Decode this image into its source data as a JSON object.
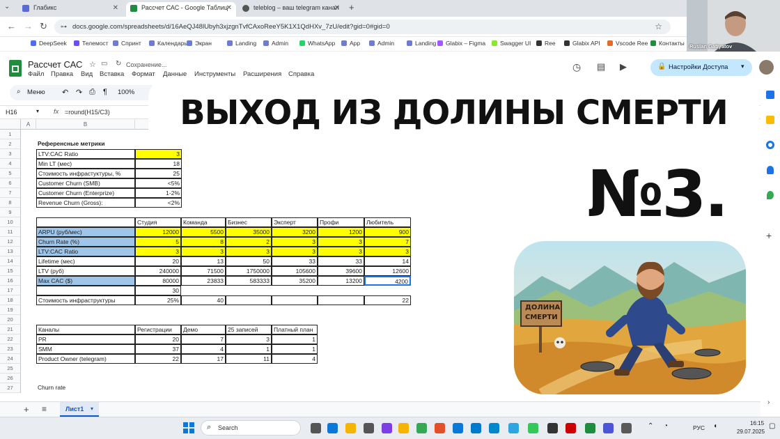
{
  "browser": {
    "tabs": [
      {
        "label": "Глабикс",
        "active": false
      },
      {
        "label": "Рассчет САС - Google Таблиц",
        "active": true
      },
      {
        "label": "teleblog – ваш telegram канал",
        "active": false
      }
    ],
    "url": "docs.google.com/spreadsheets/d/16AeQJ48lUbyh3xjzgnTvfCAxoReeY5K1X1QdHXv_7zU/edit?gid=0#gid=0",
    "bookmarks": [
      "DeepSeek",
      "Телемост",
      "Спринт",
      "Календарь",
      "Экран",
      "Landing",
      "Admin",
      "WhatsApp",
      "App",
      "Admin",
      "Landing",
      "Glabix – Figma",
      "Swagger UI",
      "Ree",
      "Glabix API",
      "Vscode Ree",
      "Контакты"
    ],
    "webcam_name": "Ruslan Gatiyatov"
  },
  "sheets": {
    "title": "Рассчет САС",
    "saving": "Сохранение...",
    "menu": [
      "Файл",
      "Правка",
      "Вид",
      "Вставка",
      "Формат",
      "Данные",
      "Инструменты",
      "Расширения",
      "Справка"
    ],
    "search_label": "Меню",
    "zoom": "100%",
    "share_label": "Настройки Доступа",
    "cell_ref": "H16",
    "formula": "=round(H15/C3)",
    "sheet_tab": "Лист1"
  },
  "grid": {
    "columns": [
      "A",
      "B"
    ],
    "rows": [
      "1",
      "2",
      "3",
      "4",
      "5",
      "6",
      "7",
      "8",
      "9",
      "10",
      "11",
      "12",
      "13",
      "14",
      "15",
      "16",
      "17",
      "18",
      "19",
      "20",
      "21",
      "22",
      "23",
      "24",
      "25",
      "26",
      "27"
    ],
    "metrics_title": "Референсные метрики",
    "metrics": [
      [
        "LTV:CAC Ratio",
        "3"
      ],
      [
        "Min LT (мес)",
        "18"
      ],
      [
        "Стоимость инфрастуктуры, %",
        "25"
      ],
      [
        "Customer Churn (SMB)",
        "<5%"
      ],
      [
        "Customer Churn (Enterprize)",
        "1-2%"
      ],
      [
        "Revenue Churn (Gross):",
        "<2%"
      ]
    ],
    "plans_header": [
      "Студия",
      "Команда",
      "Бизнес",
      "Эксперт",
      "Профи",
      "Любитель"
    ],
    "plans_rows": [
      {
        "label": "ARPU (руб/мес)",
        "values": [
          "12000",
          "5500",
          "35000",
          "3200",
          "1200",
          "900"
        ]
      },
      {
        "label": "Churn Rate (%)",
        "values": [
          "5",
          "8",
          "2",
          "3",
          "3",
          "7"
        ]
      },
      {
        "label": "LTV:CAC Ratio",
        "values": [
          "3",
          "3",
          "3",
          "3",
          "3",
          "3"
        ]
      },
      {
        "label": "Lifetime (мес)",
        "values": [
          "20",
          "13",
          "50",
          "33",
          "33",
          "14"
        ]
      },
      {
        "label": "LTV (руб)",
        "values": [
          "240000",
          "71500",
          "1750000",
          "105600",
          "39600",
          "12600"
        ]
      },
      {
        "label": "Max CAC ($)",
        "values": [
          "80000",
          "23833",
          "583333",
          "35200",
          "13200",
          "4200"
        ]
      }
    ],
    "row17_value": "30",
    "infra_label": "Стоимость инфраструктуры",
    "infra_values": [
      "25%",
      "40",
      "",
      "",
      "",
      "22"
    ],
    "channels_header": [
      "Каналы",
      "Регистрации",
      "Демо",
      "25 записей",
      "Платный план"
    ],
    "channels": [
      [
        "PR",
        "20",
        "7",
        "3",
        "1"
      ],
      [
        "SMM",
        "37",
        "4",
        "1",
        "1"
      ],
      [
        "Product Owner (telegram)",
        "22",
        "17",
        "11",
        "4"
      ]
    ],
    "churn_label": "Churn rate"
  },
  "overlay": {
    "headline": "ВЫХОД ИЗ ДОЛИНЫ СМЕРТИ",
    "episode": "№3.",
    "sign_line1": "ДОЛИНА",
    "sign_line2": "СМЕРТИ"
  },
  "taskbar": {
    "search": "Search",
    "lang": "РУС",
    "time": "16:15",
    "date": "29.07.2025"
  }
}
